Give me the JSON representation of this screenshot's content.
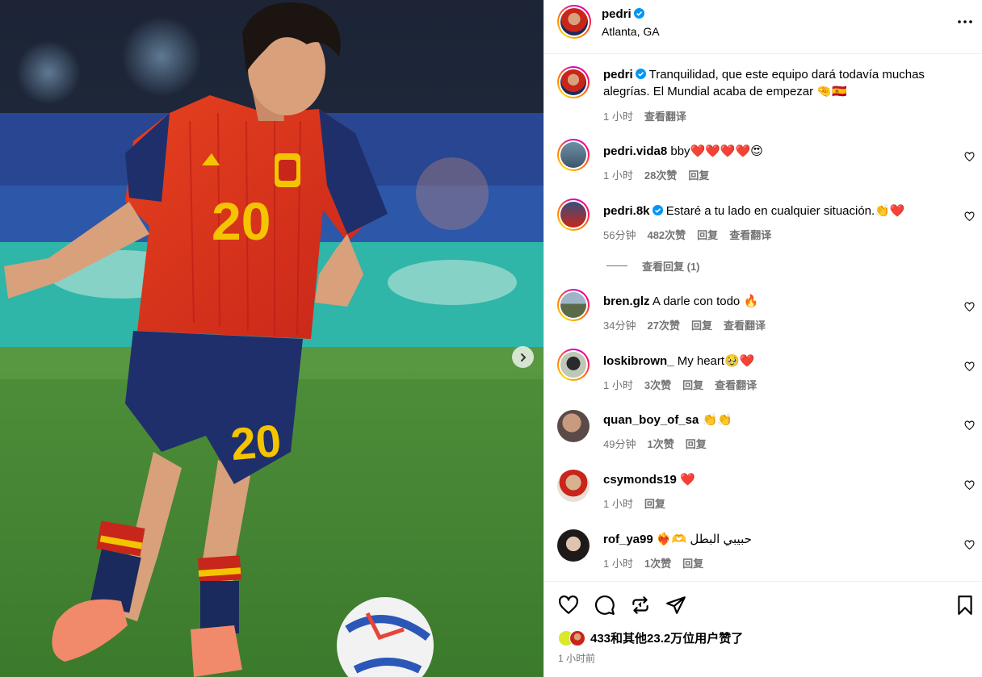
{
  "post": {
    "username": "pedri",
    "location": "Atlanta, GA",
    "caption": "Tranquilidad, que este equipo dará todavía muchas alegrías. El Mundial acaba de empezar 🤏🇪🇸",
    "caption_time": "1 小时",
    "caption_translate": "查看翻译",
    "jersey_number": "20"
  },
  "comments": [
    {
      "user": "pedri.vida8",
      "verified": false,
      "text": "bby❤️❤️❤️❤️😍",
      "time": "1 小时",
      "likes": "28次赞",
      "reply": "回复",
      "translate": ""
    },
    {
      "user": "pedri.8k",
      "verified": true,
      "text": "Estaré a tu lado en cualquier situación.👏❤️",
      "time": "56分钟",
      "likes": "482次赞",
      "reply": "回复",
      "translate": "查看翻译"
    },
    {
      "user": "bren.glz",
      "verified": false,
      "text": "A darle con todo 🔥",
      "time": "34分钟",
      "likes": "27次赞",
      "reply": "回复",
      "translate": "查看翻译"
    },
    {
      "user": "loskibrown_",
      "verified": false,
      "text": "My heart🥹❤️",
      "time": "1 小时",
      "likes": "3次赞",
      "reply": "回复",
      "translate": "查看翻译"
    },
    {
      "user": "quan_boy_of_sa",
      "verified": false,
      "text": "👏👏",
      "time": "49分钟",
      "likes": "1次赞",
      "reply": "回复",
      "translate": ""
    },
    {
      "user": "csymonds19",
      "verified": false,
      "text": "❤️",
      "time": "1 小时",
      "likes": "",
      "reply": "回复",
      "translate": ""
    },
    {
      "user": "rof_ya99",
      "verified": false,
      "text": "❤️‍🔥🫶 حبيبي البطل",
      "time": "1 小时",
      "likes": "1次赞",
      "reply": "回复",
      "translate": ""
    }
  ],
  "view_replies": "查看回复 (1)",
  "likes_summary": "433和其他23.2万位用户赞了",
  "posted_ago": "1 小时前",
  "icons": [
    "verified-badge-icon",
    "more-options-icon",
    "heart-icon",
    "comment-icon",
    "repost-icon",
    "share-icon",
    "save-icon",
    "next-slide-icon"
  ],
  "colors": {
    "verified": "#0095f6",
    "meta": "#737373",
    "divider": "#efefef",
    "heart_red": "#ff3040"
  }
}
